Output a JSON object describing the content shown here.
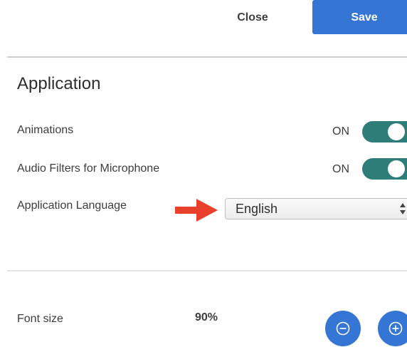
{
  "header": {
    "close_label": "Close",
    "save_label": "Save"
  },
  "application": {
    "title": "Application",
    "animations": {
      "label": "Animations",
      "state_text": "ON",
      "on": true
    },
    "audio_filters": {
      "label": "Audio Filters for Microphone",
      "state_text": "ON",
      "on": true
    },
    "language": {
      "label": "Application Language",
      "selected": "English"
    }
  },
  "font": {
    "label": "Font size",
    "value": "90%"
  },
  "icons": {
    "decrease": "minus-circle-icon",
    "increase": "plus-circle-icon",
    "annotation": "red-arrow-icon",
    "select_caret": "updown-caret-icon"
  },
  "colors": {
    "primary": "#3575d3",
    "toggle_on": "#2e7d79",
    "arrow": "#e8402a"
  }
}
